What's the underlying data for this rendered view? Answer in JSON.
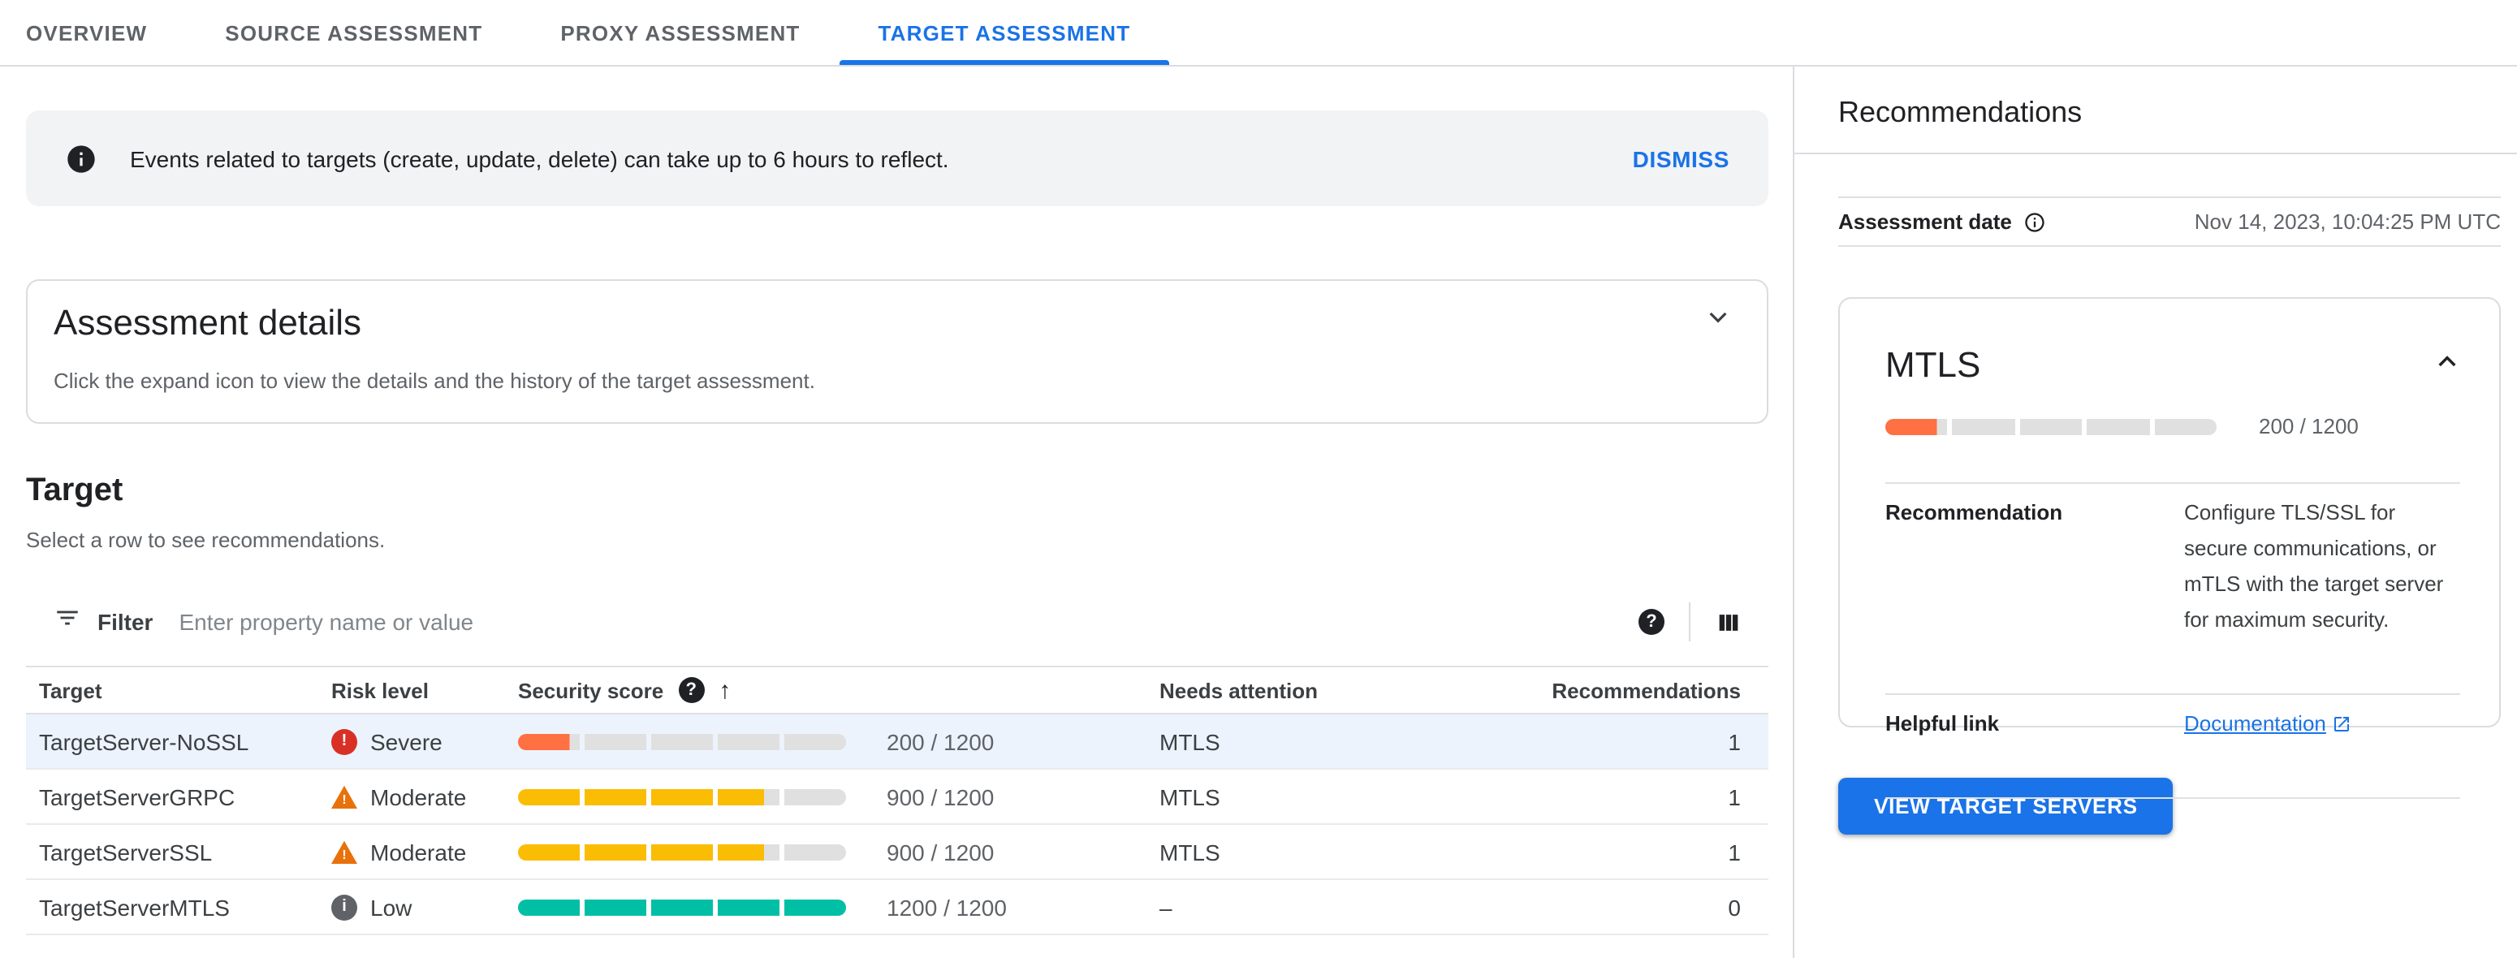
{
  "tabs": [
    {
      "label": "OVERVIEW",
      "active": false
    },
    {
      "label": "SOURCE ASSESSMENT",
      "active": false
    },
    {
      "label": "PROXY ASSESSMENT",
      "active": false
    },
    {
      "label": "TARGET ASSESSMENT",
      "active": true
    }
  ],
  "banner": {
    "text": "Events related to targets (create, update, delete) can take up to 6 hours to reflect.",
    "dismiss_label": "DISMISS"
  },
  "assessment_details": {
    "title": "Assessment details",
    "subtitle": "Click the expand icon to view the details and the history of the target assessment."
  },
  "target_section": {
    "title": "Target",
    "subtitle": "Select a row to see recommendations."
  },
  "filter": {
    "label": "Filter",
    "placeholder": "Enter property name or value"
  },
  "table": {
    "columns": {
      "target": "Target",
      "risk": "Risk level",
      "score": "Security score",
      "needs_attention": "Needs attention",
      "recommendations": "Recommendations"
    },
    "score_max": 1200,
    "rows": [
      {
        "target": "TargetServer-NoSSL",
        "risk": "Severe",
        "risk_level": "sev",
        "score": 200,
        "score_text": "200 / 1200",
        "needs_attention": "MTLS",
        "recommendations": "1",
        "selected": true,
        "bar_color": "#ff7043"
      },
      {
        "target": "TargetServerGRPC",
        "risk": "Moderate",
        "risk_level": "mod",
        "score": 900,
        "score_text": "900 / 1200",
        "needs_attention": "MTLS",
        "recommendations": "1",
        "selected": false,
        "bar_color": "#fbbc04"
      },
      {
        "target": "TargetServerSSL",
        "risk": "Moderate",
        "risk_level": "mod",
        "score": 900,
        "score_text": "900 / 1200",
        "needs_attention": "MTLS",
        "recommendations": "1",
        "selected": false,
        "bar_color": "#fbbc04"
      },
      {
        "target": "TargetServerMTLS",
        "risk": "Low",
        "risk_level": "low",
        "score": 1200,
        "score_text": "1200 / 1200",
        "needs_attention": "–",
        "recommendations": "0",
        "selected": false,
        "bar_color": "#00bfa5"
      }
    ]
  },
  "panel": {
    "title": "Recommendations",
    "assessment_date_label": "Assessment date",
    "assessment_date_value": "Nov 14, 2023, 10:04:25 PM UTC",
    "card": {
      "title": "MTLS",
      "score": 200,
      "score_text": "200 / 1200",
      "bar_color": "#ff7043",
      "recommendation_label": "Recommendation",
      "recommendation_text": "Configure TLS/SSL for secure communications, or mTLS with the target server for maximum security.",
      "helpful_link_label": "Helpful link",
      "link_text": "Documentation"
    },
    "button_label": "VIEW TARGET SERVERS"
  },
  "colors": {
    "accent_blue": "#1a73e8",
    "severe_red": "#d93025",
    "moderate_orange": "#e8710a",
    "low_gray": "#5f6368",
    "bar_track": "#e0e0e0",
    "selected_row": "#edf3fd"
  }
}
